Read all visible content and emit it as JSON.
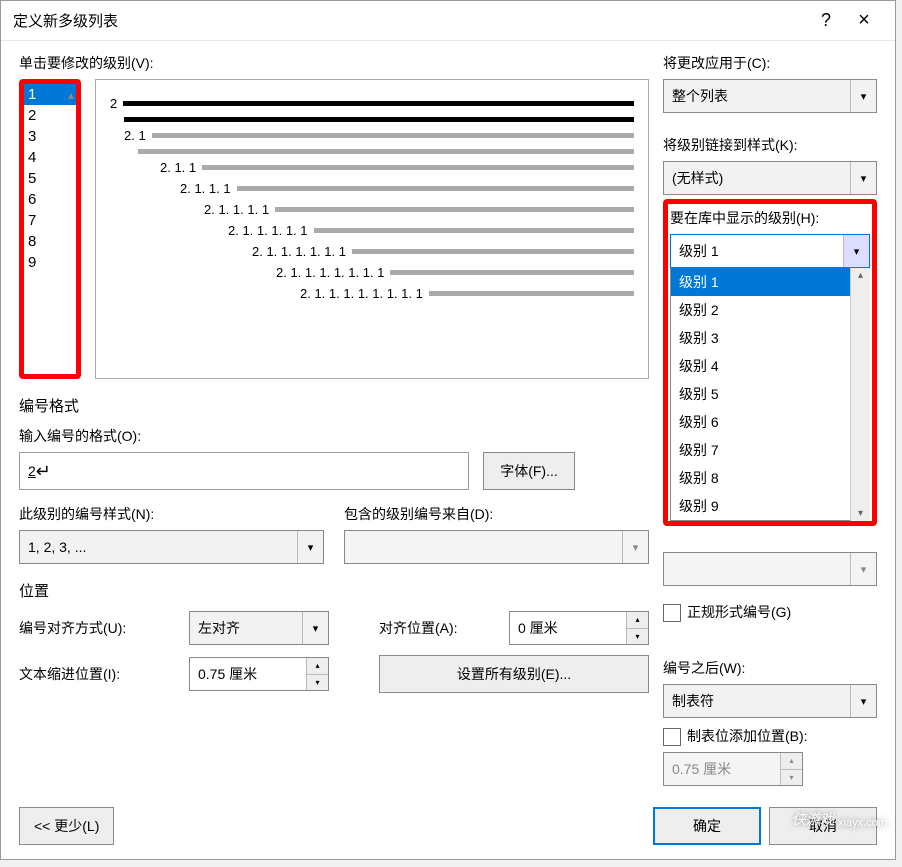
{
  "title": "定义新多级列表",
  "help": "?",
  "close": "×",
  "left": {
    "click_level_label": "单击要修改的级别(V):",
    "levels": [
      "1",
      "2",
      "3",
      "4",
      "5",
      "6",
      "7",
      "8",
      "9"
    ],
    "selected_level": "1",
    "preview_numbers": [
      "2",
      "",
      "2. 1",
      "",
      "2. 1. 1",
      "2. 1. 1. 1",
      "2. 1. 1. 1. 1",
      "2. 1. 1. 1. 1. 1",
      "2. 1. 1. 1. 1. 1. 1",
      "2. 1. 1. 1. 1. 1. 1. 1",
      "2. 1. 1. 1. 1. 1. 1. 1. 1"
    ]
  },
  "right": {
    "apply_to_label": "将更改应用于(C):",
    "apply_to_value": "整个列表",
    "link_style_label": "将级别链接到样式(K):",
    "link_style_value": "(无样式)",
    "show_level_label": "要在库中显示的级别(H):",
    "show_level_value": "级别 1",
    "dropdown_options": [
      "级别 1",
      "级别 2",
      "级别 3",
      "级别 4",
      "级别 5",
      "级别 6",
      "级别 7",
      "级别 8",
      "级别 9"
    ],
    "dropdown_selected": "级别 1",
    "legal_checkbox": "正规形式编号(G)",
    "after_label": "编号之后(W):",
    "after_value": "制表符",
    "tab_pos_checkbox": "制表位添加位置(B):",
    "tab_pos_value": "0.75 厘米"
  },
  "format": {
    "section_title": "编号格式",
    "enter_format_label": "输入编号的格式(O):",
    "enter_format_value": "2",
    "font_btn": "字体(F)...",
    "num_style_label": "此级别的编号样式(N):",
    "num_style_value": "1, 2, 3, ...",
    "include_prev_label": "包含的级别编号来自(D):"
  },
  "position": {
    "section_title": "位置",
    "align_label": "编号对齐方式(U):",
    "align_value": "左对齐",
    "align_at_label": "对齐位置(A):",
    "align_at_value": "0 厘米",
    "indent_label": "文本缩进位置(I):",
    "indent_value": "0.75 厘米",
    "set_all_btn": "设置所有级别(E)..."
  },
  "bottom": {
    "less_btn": "<< 更少(L)",
    "ok_btn": "确定",
    "cancel_btn": "取消"
  },
  "watermark": {
    "brand": "侠游戏",
    "url": "xiayx.com"
  }
}
